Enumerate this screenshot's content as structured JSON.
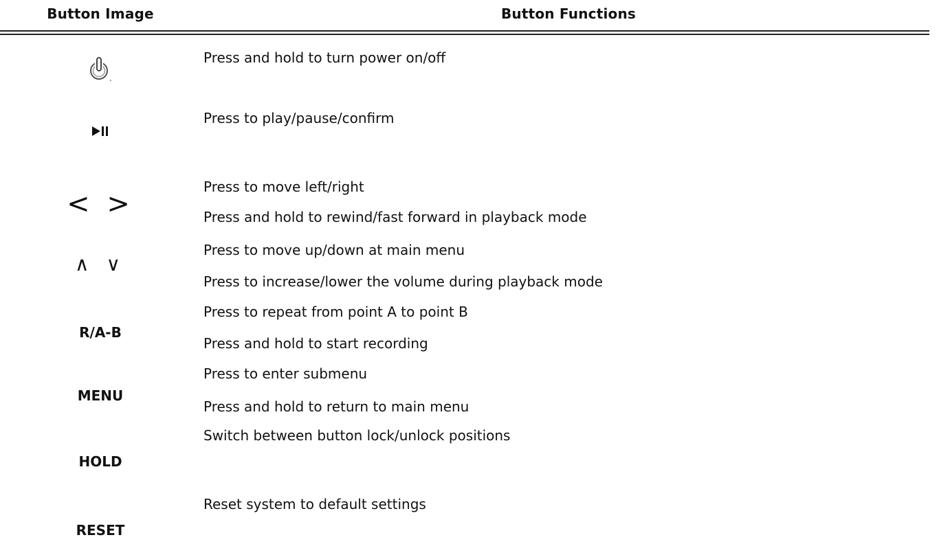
{
  "header": {
    "col_image": "Button Image",
    "col_functions": "Button Functions"
  },
  "rows": [
    {
      "icon": "power-icon",
      "label": "",
      "functions": [
        "Press and hold to turn power on/off"
      ]
    },
    {
      "icon": "play-pause-icon",
      "label": "",
      "functions": [
        "Press to play/pause/confirm"
      ]
    },
    {
      "icon": "left-right-arrows-icon",
      "label": "< >",
      "functions": [
        "Press to move left/right",
        "Press and hold to rewind/fast forward in playback mode"
      ]
    },
    {
      "icon": "up-down-arrows-icon",
      "label": "∧ ∨",
      "functions": [
        "Press to move up/down at main menu",
        "Press to increase/lower the volume during playback mode"
      ]
    },
    {
      "icon": "",
      "label": "R/A-B",
      "functions": [
        "Press to repeat from point A to point B",
        "Press and hold to start recording"
      ]
    },
    {
      "icon": "",
      "label": "MENU",
      "functions": [
        "Press to enter submenu",
        "Press and hold to return to main menu"
      ]
    },
    {
      "icon": "",
      "label": "HOLD",
      "functions": [
        "Switch between button lock/unlock positions"
      ]
    },
    {
      "icon": "",
      "label": "RESET",
      "functions": [
        "Reset system to default settings"
      ]
    }
  ]
}
